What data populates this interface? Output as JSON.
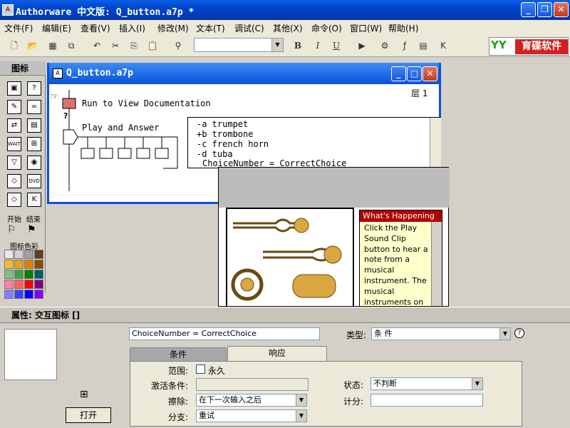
{
  "app": {
    "title": "Authorware 中文版: Q_button.a7p *"
  },
  "menu": [
    "文件(F)",
    "编辑(E)",
    "查看(V)",
    "插入(I)",
    "修改(M)",
    "文本(T)",
    "调试(C)",
    "其他(X)",
    "命令(O)",
    "窗口(W)",
    "帮助(H)"
  ],
  "toolbar": {
    "font_combo_value": "",
    "bold": "B",
    "italic": "I",
    "underline": "U"
  },
  "brand": {
    "logo": "YY",
    "name": "育碟软件"
  },
  "palette": {
    "title": "图标",
    "start": "开始",
    "end": "结束",
    "color_label": "图标色彩",
    "colors": [
      "#e8e8e8",
      "#d0d0d0",
      "#a0a0a0",
      "#604020",
      "#f0c030",
      "#e8a020",
      "#e08000",
      "#904800",
      "#80c080",
      "#40a040",
      "#008000",
      "#006060",
      "#ff80a0",
      "#ff6060",
      "#ff0000",
      "#800080",
      "#8080ff",
      "#4040ff",
      "#0000ff",
      "#8000ff"
    ]
  },
  "flowwin": {
    "title": "Q_button.a7p",
    "level": "层 1",
    "icon1_label": "Run to View Documentation",
    "icon2_label": "Play and Answer",
    "responses": [
      "-a trumpet",
      "+b trombone",
      "-c french horn",
      "-d tuba"
    ],
    "calc": "ChoiceNumber = CorrectChoice"
  },
  "happening": {
    "title": "What's Happening",
    "text": "Click the Play Sound Clip button to hear a note from a musical instrument. The musical instruments on the left are"
  },
  "properties": {
    "header": "属性: 交互图标 []",
    "name_value": "ChoiceNumber = CorrectChoice",
    "type_label": "类型:",
    "type_value": "条 件",
    "tab_condition": "条件",
    "tab_response": "响应",
    "scope_label": "范围:",
    "permanent_label": "永久",
    "activate_label": "激活条件:",
    "erase_label": "擦除:",
    "erase_value": "在下一次输入之后",
    "branch_label": "分支:",
    "branch_value": "重试",
    "status_label": "状态:",
    "status_value": "不判断",
    "score_label": "计分:",
    "open_button": "打开"
  }
}
